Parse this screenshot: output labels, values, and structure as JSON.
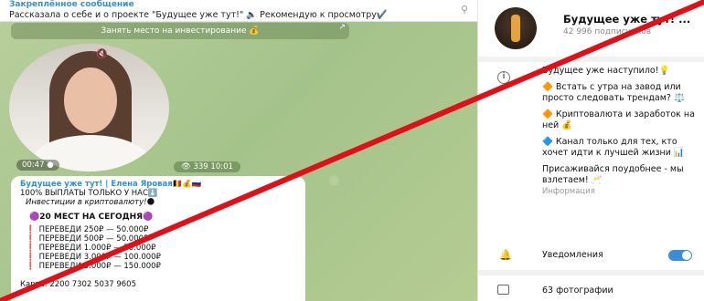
{
  "pinned": {
    "title": "Закреплённое сообщение",
    "text": "Рассказала о себе и о проекте \"Будущее уже тут!\" 🔈 Рекомендую к просмотру✔️",
    "pin_icon": "pin-list-icon"
  },
  "invest_button": {
    "label": "Занять место на инвестирование 💰",
    "arrow": "↗"
  },
  "video": {
    "duration": "00:47 ●",
    "views": "👁 339  10:01",
    "mute_icon": "🔇"
  },
  "message": {
    "author": "Будущее уже тут! | Елена Яровая🇧🇪💰🇷🇺",
    "line1": "100% ВЫПЛАТЫ ТОЛЬКО У НАС⬇️",
    "line2": "Инвестиции в криптовалюту!🌑",
    "spots": "🟣20 МЕСТ НА СЕГОДНЯ🟣",
    "payments": [
      "ПЕРЕВЕДИ 250₽  — 50.000₽",
      "ПЕРЕВЕДИ 500₽ — 50.000₽",
      "ПЕРЕВЕДИ 1.000₽ — 70.000₽",
      "ПЕРЕВЕДИ 3.000₽ — 100.000₽",
      "ПЕРЕВЕДИ 5.000₽ — 150.000₽"
    ],
    "card": "Карта:  2200 7302 5037 9605"
  },
  "channel": {
    "title": "Будущее уже тут! ...",
    "subscribers": "42 996 подписчиков"
  },
  "description": {
    "p1": "Будущее уже наступило!💡",
    "p2": "🔶 Встать с утра на завод или просто    следовать трендам? ⚖️",
    "p3": "🔶 Криптовалюта и заработок на ней 💰",
    "p4": "🔷 Канал только для тех, кто хочет идти к лучшей жизни 📊",
    "p5": "Присаживайся поудобнее - мы взлетаем! 🥂",
    "label": "Информация"
  },
  "notifications": {
    "label": "Уведомления",
    "enabled": true
  },
  "photos": {
    "label": "63 фотографии"
  },
  "colors": {
    "accent": "#3a8ed6",
    "cross": "#e01018",
    "chat_bg": "#aec996"
  }
}
